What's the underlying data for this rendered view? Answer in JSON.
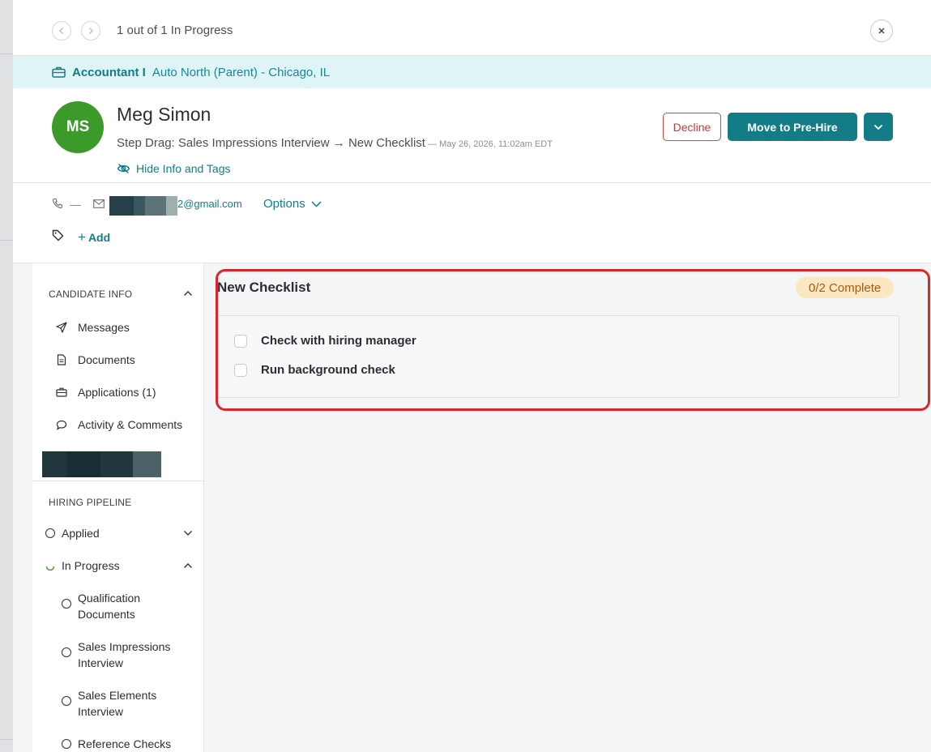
{
  "nav": {
    "counter": "1 out of 1 In Progress"
  },
  "job": {
    "title": "Accountant I",
    "location": "Auto North (Parent) - Chicago, IL"
  },
  "candidate": {
    "initials": "MS",
    "name": "Meg Simon",
    "stage_text": "Step Drag: Sales Impressions Interview → New Checklist",
    "timestamp": " — May 26, 2026, 11:02am EDT",
    "hide_info_label": "Hide Info and Tags"
  },
  "actions": {
    "decline": "Decline",
    "move": "Move to Pre-Hire"
  },
  "contact": {
    "phone": "—",
    "email_suffix": "2@gmail.com",
    "options_label": "Options",
    "add_tag_label": "Add"
  },
  "sidebar": {
    "candidate_info_heading": "CANDIDATE INFO",
    "items": [
      {
        "label": "Messages",
        "icon": "send-icon"
      },
      {
        "label": "Documents",
        "icon": "document-icon"
      },
      {
        "label": "Applications (1)",
        "icon": "briefcase-icon"
      },
      {
        "label": "Activity & Comments",
        "icon": "comment-icon"
      }
    ],
    "pipeline_heading": "HIRING PIPELINE",
    "pipeline": [
      {
        "label": "Applied"
      },
      {
        "label": "In Progress"
      },
      {
        "label": "Qualification Documents"
      },
      {
        "label": "Sales Impressions Interview"
      },
      {
        "label": "Sales Elements Interview"
      },
      {
        "label": "Reference Checks"
      }
    ]
  },
  "checklist": {
    "title": "New Checklist",
    "progress": "0/2 Complete",
    "completed": 0,
    "total": 2,
    "items": [
      {
        "label": "Check with hiring manager",
        "checked": false
      },
      {
        "label": "Run background check",
        "checked": false
      }
    ]
  },
  "colors": {
    "accent": "#137c87",
    "avatar": "#3c9a2a",
    "decline": "#d64545",
    "highlight": "#d9272e",
    "badge_bg": "#fbe8c3"
  }
}
